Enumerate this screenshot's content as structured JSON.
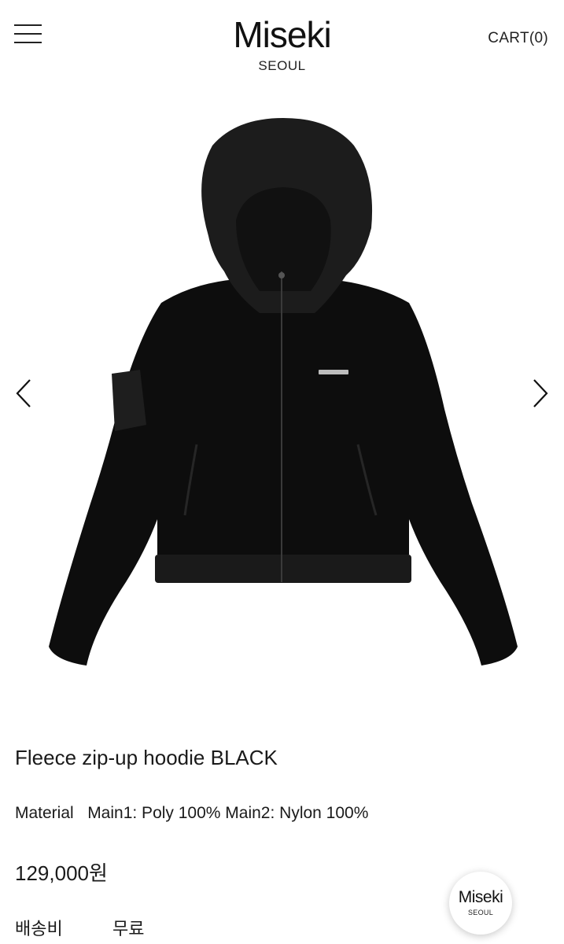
{
  "header": {
    "brand_name": "Miseki",
    "brand_city": "SEOUL",
    "cart_label": "CART(0)"
  },
  "gallery": {
    "image_subject": "black fleece zip-up hoodie with nylon hood and hem",
    "prev_icon": "chevron-left-icon",
    "next_icon": "chevron-right-icon"
  },
  "product": {
    "title": "Fleece zip-up hoodie BLACK",
    "material": "Material   Main1: Poly 100% Main2: Nylon 100%",
    "price": "129,000원",
    "shipping_label": "배송비",
    "shipping_value": "무료"
  },
  "floating_logo": {
    "name": "Miseki",
    "city": "SEOUL"
  },
  "colors": {
    "background": "#ffffff",
    "text": "#1a1a1a",
    "garment": "#0d0d0d"
  }
}
